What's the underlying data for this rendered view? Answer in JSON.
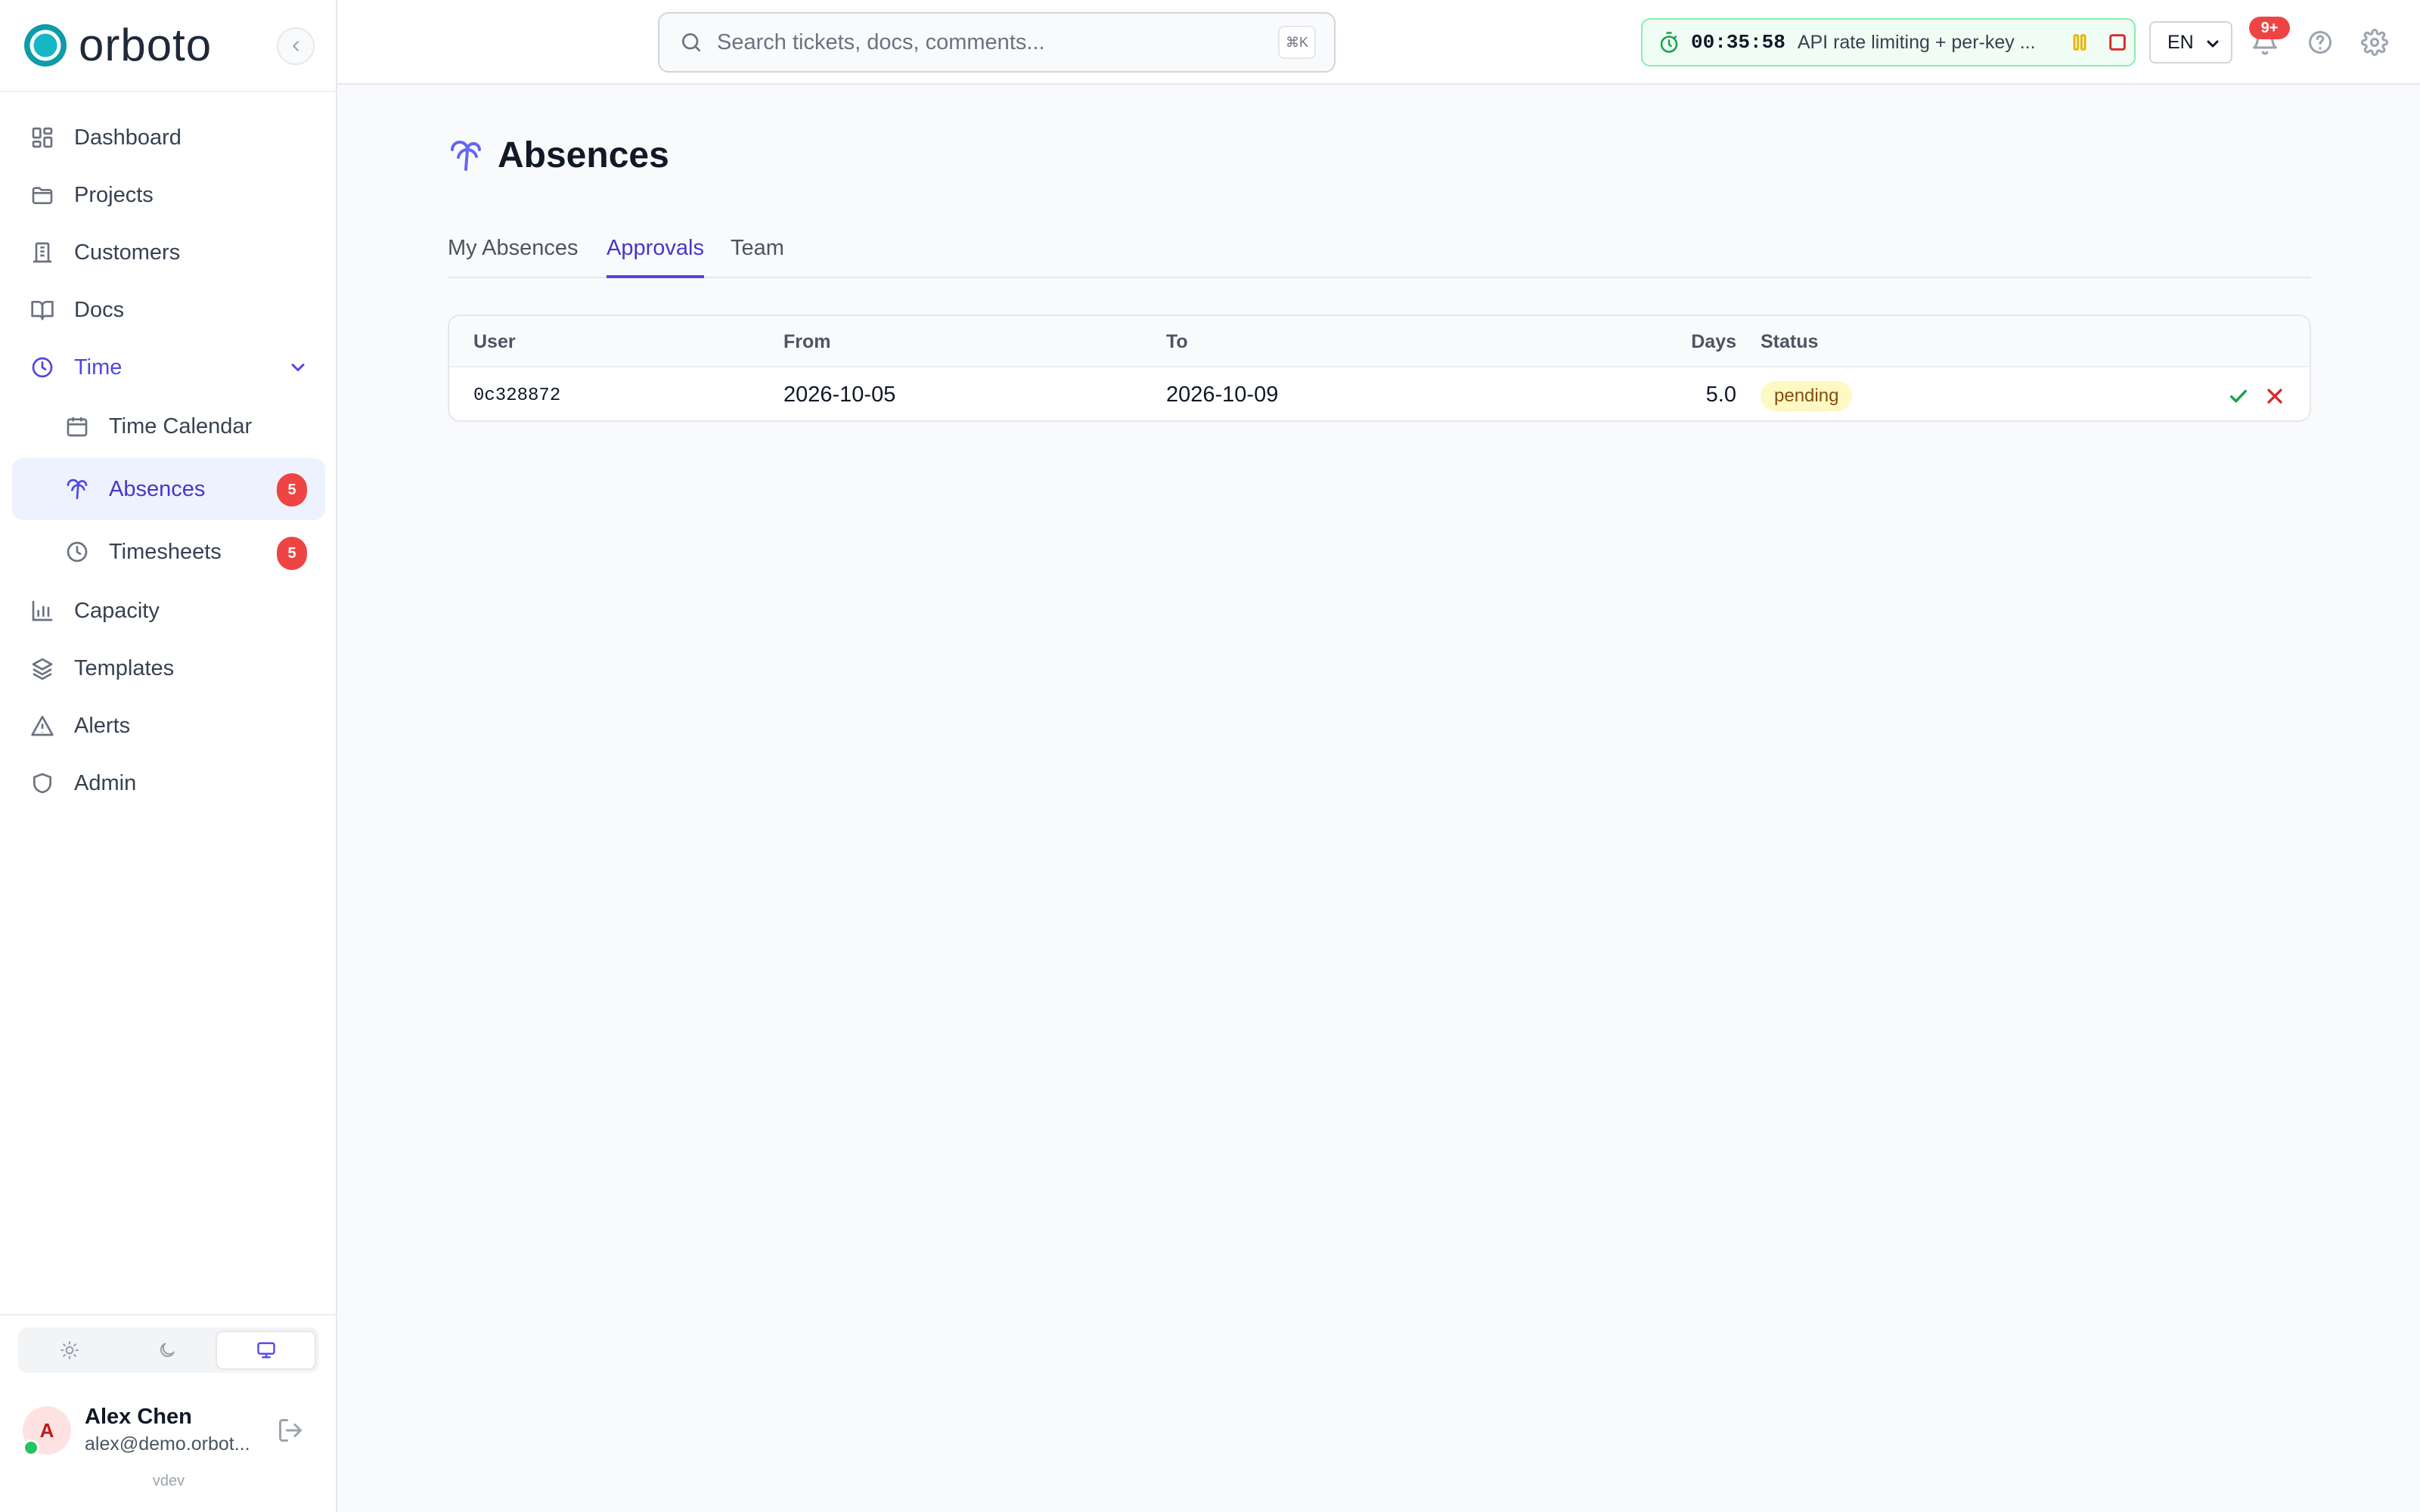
{
  "brand": {
    "name": "orboto",
    "accent": "#0d9ca8"
  },
  "sidebar": {
    "items": [
      {
        "label": "Dashboard",
        "icon": "dashboard-icon"
      },
      {
        "label": "Projects",
        "icon": "folder-icon"
      },
      {
        "label": "Customers",
        "icon": "building-icon"
      },
      {
        "label": "Docs",
        "icon": "book-icon"
      },
      {
        "label": "Time",
        "icon": "clock-icon",
        "expanded": true,
        "children": [
          {
            "label": "Time Calendar",
            "icon": "calendar-icon"
          },
          {
            "label": "Absences",
            "icon": "palm-tree-icon",
            "badge": "5",
            "active": true
          },
          {
            "label": "Timesheets",
            "icon": "clock-icon",
            "badge": "5"
          }
        ]
      },
      {
        "label": "Capacity",
        "icon": "bar-chart-icon"
      },
      {
        "label": "Templates",
        "icon": "layers-icon"
      },
      {
        "label": "Alerts",
        "icon": "alert-triangle-icon"
      },
      {
        "label": "Admin",
        "icon": "shield-icon"
      }
    ],
    "theme_options": [
      "light",
      "dark",
      "system"
    ],
    "theme_selected": "system"
  },
  "user": {
    "initial": "A",
    "name": "Alex Chen",
    "email": "alex@demo.orbot...",
    "version": "vdev"
  },
  "topbar": {
    "search_placeholder": "Search tickets, docs, comments...",
    "search_shortcut": "⌘K",
    "timer": {
      "time": "00:35:58",
      "task": "API rate limiting + per-key ..."
    },
    "language": "EN",
    "notifications_badge": "9+"
  },
  "page": {
    "title": "Absences",
    "tabs": [
      {
        "label": "My Absences",
        "active": false
      },
      {
        "label": "Approvals",
        "active": true
      },
      {
        "label": "Team",
        "active": false
      }
    ]
  },
  "table": {
    "columns": [
      "User",
      "From",
      "To",
      "Days",
      "Status"
    ],
    "rows": [
      {
        "user": "0c328872",
        "from": "2026-10-05",
        "to": "2026-10-09",
        "days": "5.0",
        "status": "pending"
      }
    ]
  },
  "colors": {
    "primary": "#4f46e5",
    "danger": "#ef4444",
    "success": "#16a34a",
    "pending_bg": "#fef9c3"
  }
}
